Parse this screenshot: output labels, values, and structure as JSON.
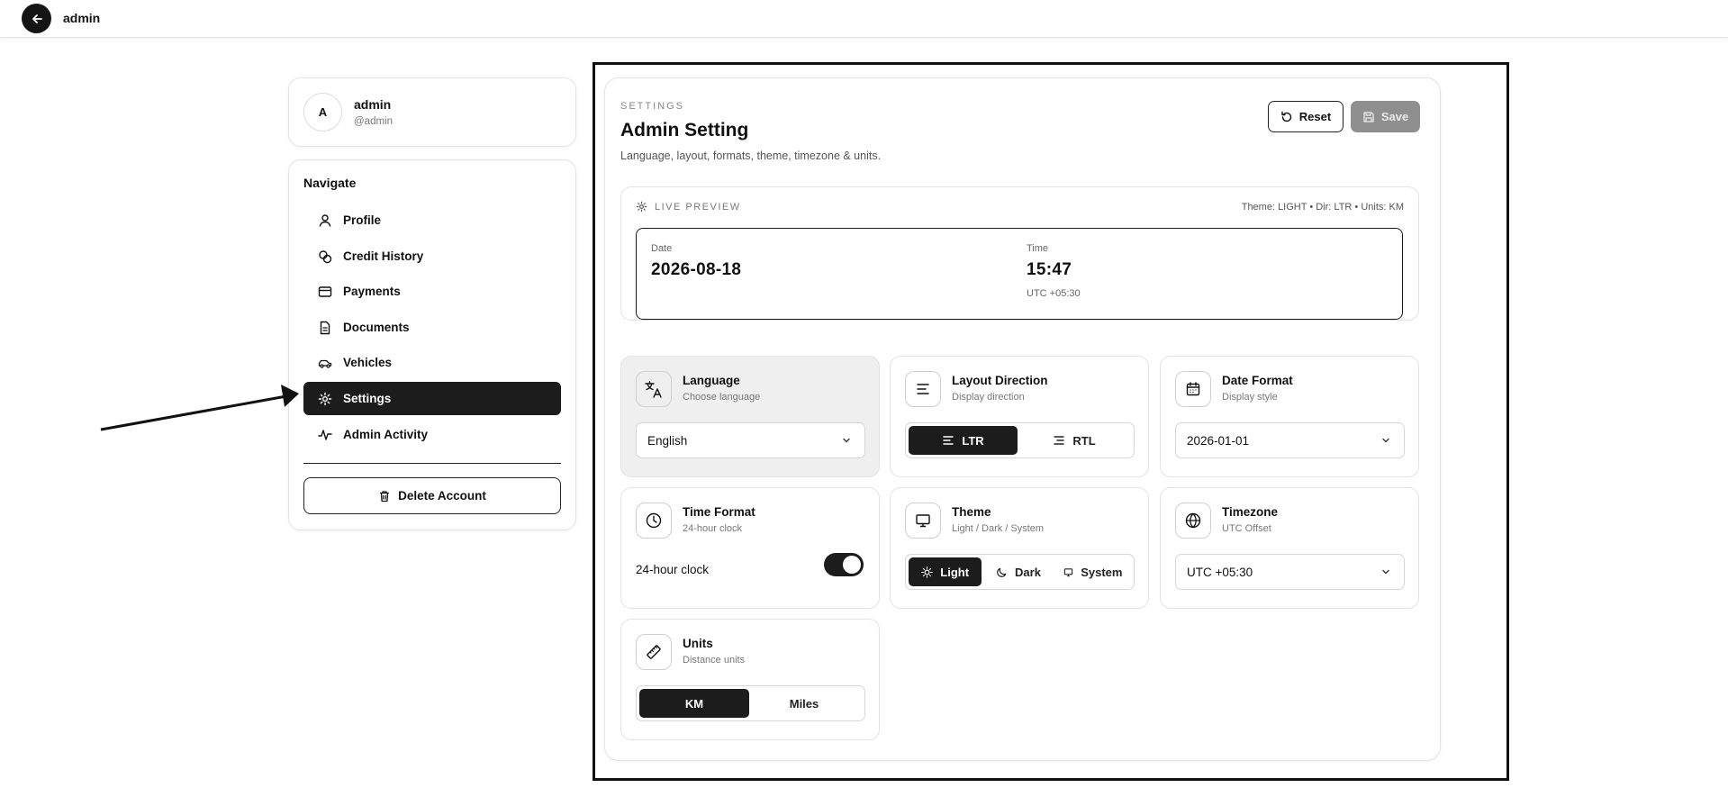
{
  "topbar": {
    "title": "admin"
  },
  "profile": {
    "initial": "A",
    "name": "admin",
    "handle": "@admin"
  },
  "nav": {
    "heading": "Navigate",
    "items": [
      {
        "label": "Profile",
        "icon": "user-icon"
      },
      {
        "label": "Credit History",
        "icon": "coins-icon"
      },
      {
        "label": "Payments",
        "icon": "credit-card-icon"
      },
      {
        "label": "Documents",
        "icon": "document-icon"
      },
      {
        "label": "Vehicles",
        "icon": "car-icon"
      },
      {
        "label": "Settings",
        "icon": "gear-icon",
        "active": true
      },
      {
        "label": "Admin Activity",
        "icon": "activity-icon"
      }
    ],
    "delete_label": "Delete Account"
  },
  "main": {
    "eyebrow": "SETTINGS",
    "title": "Admin Setting",
    "subtitle": "Language, layout, formats, theme, timezone & units.",
    "reset_label": "Reset",
    "save_label": "Save"
  },
  "preview": {
    "label": "LIVE PREVIEW",
    "meta": "Theme: LIGHT • Dir: LTR • Units: KM",
    "date_label": "Date",
    "date_value": "2026-08-18",
    "time_label": "Time",
    "time_value": "15:47",
    "timezone": "UTC +05:30"
  },
  "settings": {
    "language": {
      "title": "Language",
      "desc": "Choose language",
      "value": "English"
    },
    "layout": {
      "title": "Layout Direction",
      "desc": "Display direction",
      "options": [
        "LTR",
        "RTL"
      ],
      "selected": "LTR"
    },
    "date_format": {
      "title": "Date Format",
      "desc": "Display style",
      "value": "2026-01-01"
    },
    "time_format": {
      "title": "Time Format",
      "desc": "24-hour clock",
      "toggle_label": "24-hour clock",
      "enabled": true
    },
    "theme": {
      "title": "Theme",
      "desc": "Light / Dark / System",
      "options": [
        "Light",
        "Dark",
        "System"
      ],
      "selected": "Light"
    },
    "timezone": {
      "title": "Timezone",
      "desc": "UTC Offset",
      "value": "UTC +05:30"
    },
    "units": {
      "title": "Units",
      "desc": "Distance units",
      "options": [
        "KM",
        "Miles"
      ],
      "selected": "KM"
    }
  },
  "colors": {
    "accent": "#1c1c1c",
    "save_disabled": "#8f8f8f",
    "highlight_card": "#efefef"
  }
}
